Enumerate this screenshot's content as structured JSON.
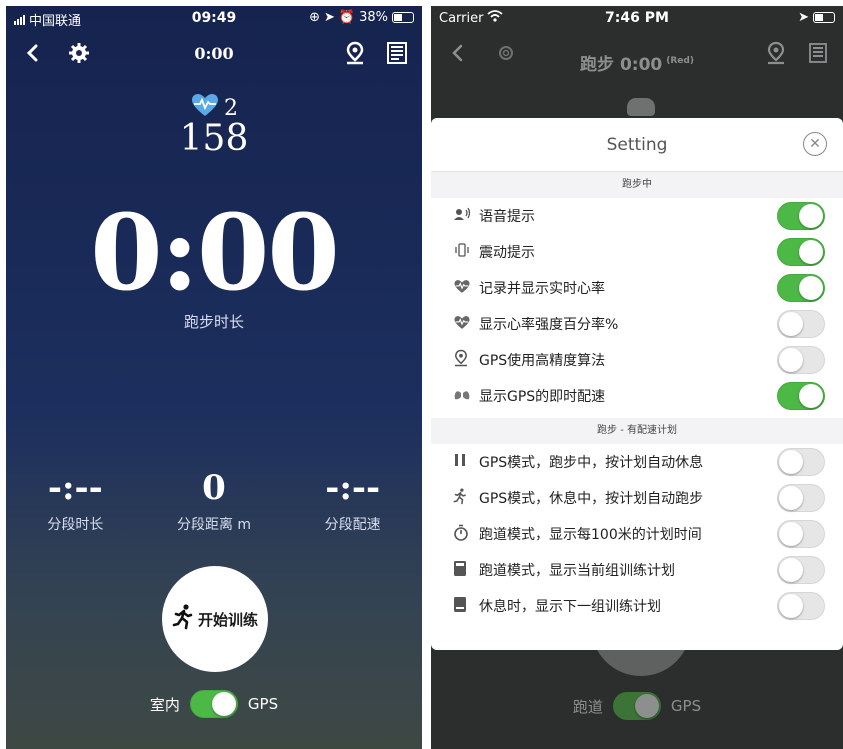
{
  "left": {
    "status": {
      "carrier": "中国联通",
      "time": "09:49",
      "battery": "38%"
    },
    "nav": {
      "title": "0:00"
    },
    "heart": {
      "zone": "2",
      "rate": "158"
    },
    "timer": {
      "value": "0:00",
      "label": "跑步时长"
    },
    "stats": [
      {
        "value": "-:--",
        "label": "分段时长"
      },
      {
        "value": "0",
        "label": "分段距离 m"
      },
      {
        "value": "-:--",
        "label": "分段配速"
      }
    ],
    "start_button": {
      "label": "开始训练"
    },
    "mode": {
      "left_label": "室内",
      "right_label": "GPS",
      "on": true
    }
  },
  "right": {
    "status": {
      "carrier": "Carrier",
      "time": "7:46 PM"
    },
    "nav": {
      "title": "跑步 0:00",
      "subtitle": "(Red)"
    },
    "mode": {
      "left_label": "跑道",
      "right_label": "GPS",
      "on": true
    },
    "modal": {
      "title": "Setting",
      "sections": [
        {
          "header": "跑步中",
          "rows": [
            {
              "icon": "voice-icon",
              "label": "语音提示",
              "on": true
            },
            {
              "icon": "vibrate-icon",
              "label": "震动提示",
              "on": true
            },
            {
              "icon": "heart-rate-icon",
              "label": "记录并显示实时心率",
              "on": true
            },
            {
              "icon": "heart-rate-icon",
              "label": "显示心率强度百分率%",
              "on": false
            },
            {
              "icon": "location-pin-icon",
              "label": "GPS使用高精度算法",
              "on": false
            },
            {
              "icon": "lungs-icon",
              "label": "显示GPS的即时配速",
              "on": true
            }
          ]
        },
        {
          "header": "跑步 - 有配速计划",
          "rows": [
            {
              "icon": "pause-icon",
              "label": "GPS模式，跑步中，按计划自动休息",
              "on": false
            },
            {
              "icon": "runner-icon",
              "label": "GPS模式，休息中，按计划自动跑步",
              "on": false
            },
            {
              "icon": "stopwatch-icon",
              "label": "跑道模式，显示每100米的计划时间",
              "on": false
            },
            {
              "icon": "calculator-icon",
              "label": "跑道模式，显示当前组训练计划",
              "on": false
            },
            {
              "icon": "card-icon",
              "label": "休息时，显示下一组训练计划",
              "on": false
            }
          ]
        }
      ]
    }
  }
}
